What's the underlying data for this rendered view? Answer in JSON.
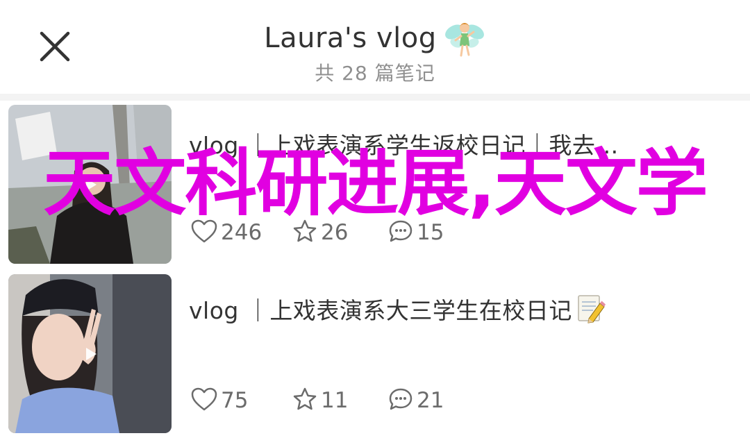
{
  "header": {
    "close_icon": "close-icon",
    "title": "Laura's vlog",
    "title_emoji": "fairy-emoji",
    "subtitle": "共 28 篇笔记"
  },
  "notes": [
    {
      "title": "vlog ｜上戏表演系学生返校日记｜我去…",
      "likes": "246",
      "favorites": "26",
      "comments": "15",
      "thumb_icon": "play-icon"
    },
    {
      "title": "vlog ｜上戏表演系大三学生在校日记",
      "title_emoji": "memo-emoji",
      "likes": "75",
      "favorites": "11",
      "comments": "21",
      "thumb_icon": "play-icon"
    }
  ],
  "watermark": {
    "text": "天文科研进展,天文学",
    "color": "#e100e1"
  },
  "colors": {
    "background": "#f3f3f3",
    "title": "#333333",
    "subtitle": "#8f8f8f",
    "stats": "#6b6b6b"
  }
}
